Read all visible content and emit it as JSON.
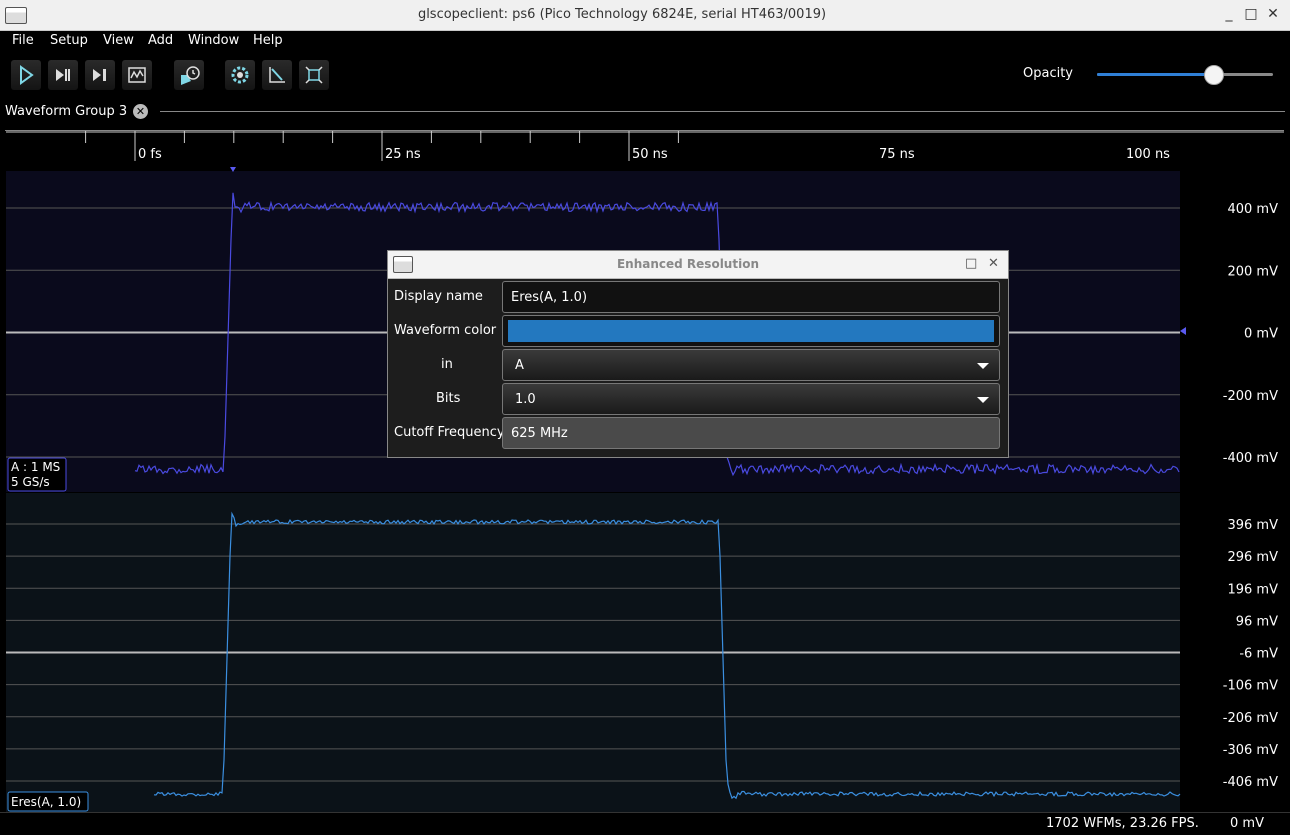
{
  "window": {
    "title": "glscopeclient: ps6 (Pico Technology 6824E, serial HT463/0019)",
    "minimize": "_",
    "maximize": "□",
    "close": "✕"
  },
  "menu": [
    "File",
    "Setup",
    "View",
    "Add",
    "Window",
    "Help"
  ],
  "toolbar": {
    "icons": [
      "play-icon",
      "single-step-icon",
      "step-icon",
      "waveform-icon",
      "history-icon",
      "settings-icon",
      "measure-icon",
      "fullscreen-icon"
    ],
    "opacity_label": "Opacity",
    "opacity_value": 0.66
  },
  "tab": {
    "label": "Waveform Group 3"
  },
  "timeline": {
    "ticks": [
      "0 fs",
      "25 ns",
      "50 ns",
      "75 ns",
      "100 ns"
    ]
  },
  "panel1": {
    "y_labels": [
      "400 mV",
      "200 mV",
      "0 mV",
      "-200 mV",
      "-400 mV"
    ],
    "channel_lines": [
      "A : 1 MS",
      "5 GS/s"
    ],
    "color": "#4a4ae0"
  },
  "panel2": {
    "y_labels": [
      "396 mV",
      "296 mV",
      "196 mV",
      "96 mV",
      "-6 mV",
      "-106 mV",
      "-206 mV",
      "-306 mV",
      "-406 mV"
    ],
    "channel_label": "Eres(A, 1.0)",
    "color": "#3b8fe0"
  },
  "status": {
    "text": "1702 WFMs, 23.26 FPS.",
    "cursor": "0 mV"
  },
  "dialog": {
    "title": "Enhanced Resolution",
    "display_name_label": "Display name",
    "display_name_value": "Eres(A, 1.0)",
    "waveform_color_label": "Waveform color",
    "waveform_color_value": "#2378bf",
    "in_label": "in",
    "in_value": "A",
    "bits_label": "Bits",
    "bits_value": "1.0",
    "cutoff_label": "Cutoff Frequency",
    "cutoff_value": "625 MHz"
  }
}
